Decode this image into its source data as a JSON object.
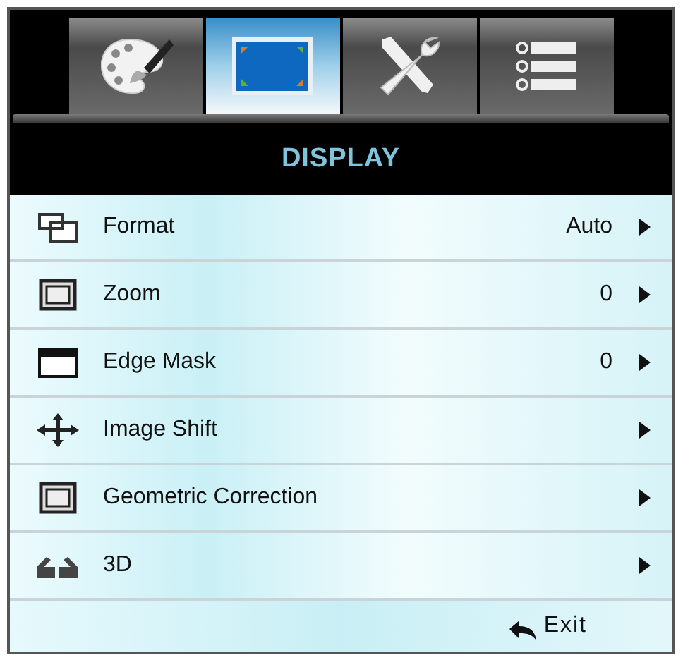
{
  "tabs": [
    {
      "kind": "palette",
      "selected": false
    },
    {
      "kind": "screen",
      "selected": true
    },
    {
      "kind": "tools",
      "selected": false
    },
    {
      "kind": "list",
      "selected": false
    }
  ],
  "title": "DISPLAY",
  "items": [
    {
      "kind": "format",
      "label": "Format",
      "value": "Auto"
    },
    {
      "kind": "zoom",
      "label": "Zoom",
      "value": "0"
    },
    {
      "kind": "mask",
      "label": "Edge Mask",
      "value": "0"
    },
    {
      "kind": "shift",
      "label": "Image Shift"
    },
    {
      "kind": "geometry",
      "label": "Geometric Correction"
    },
    {
      "kind": "glasses",
      "label": "3D"
    }
  ],
  "exit": {
    "label": "Exit"
  }
}
